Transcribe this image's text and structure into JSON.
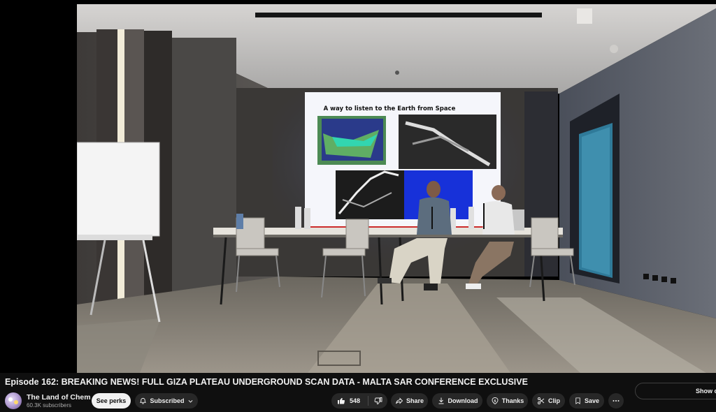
{
  "video": {
    "slide_title": "A way to listen to the Earth from Space"
  },
  "metadata": {
    "title": "Episode 162: BREAKING NEWS! FULL GIZA PLATEAU UNDERGROUND SCAN DATA - MALTA SAR CONFERENCE EXCLUSIVE"
  },
  "channel": {
    "name": "The Land of Chem",
    "subscribers": "60.3K subscribers"
  },
  "actions": {
    "see_perks": "See perks",
    "subscribed": "Subscribed",
    "like_count": "548",
    "share": "Share",
    "download": "Download",
    "thanks": "Thanks",
    "clip": "Clip",
    "save": "Save"
  },
  "sidebar": {
    "show_chat": "Show ch"
  },
  "icons": [
    "bell-icon",
    "chevron-down-icon",
    "like-icon",
    "dislike-icon",
    "share-icon",
    "download-icon",
    "thanks-icon",
    "clip-icon",
    "save-icon",
    "more-icon"
  ]
}
